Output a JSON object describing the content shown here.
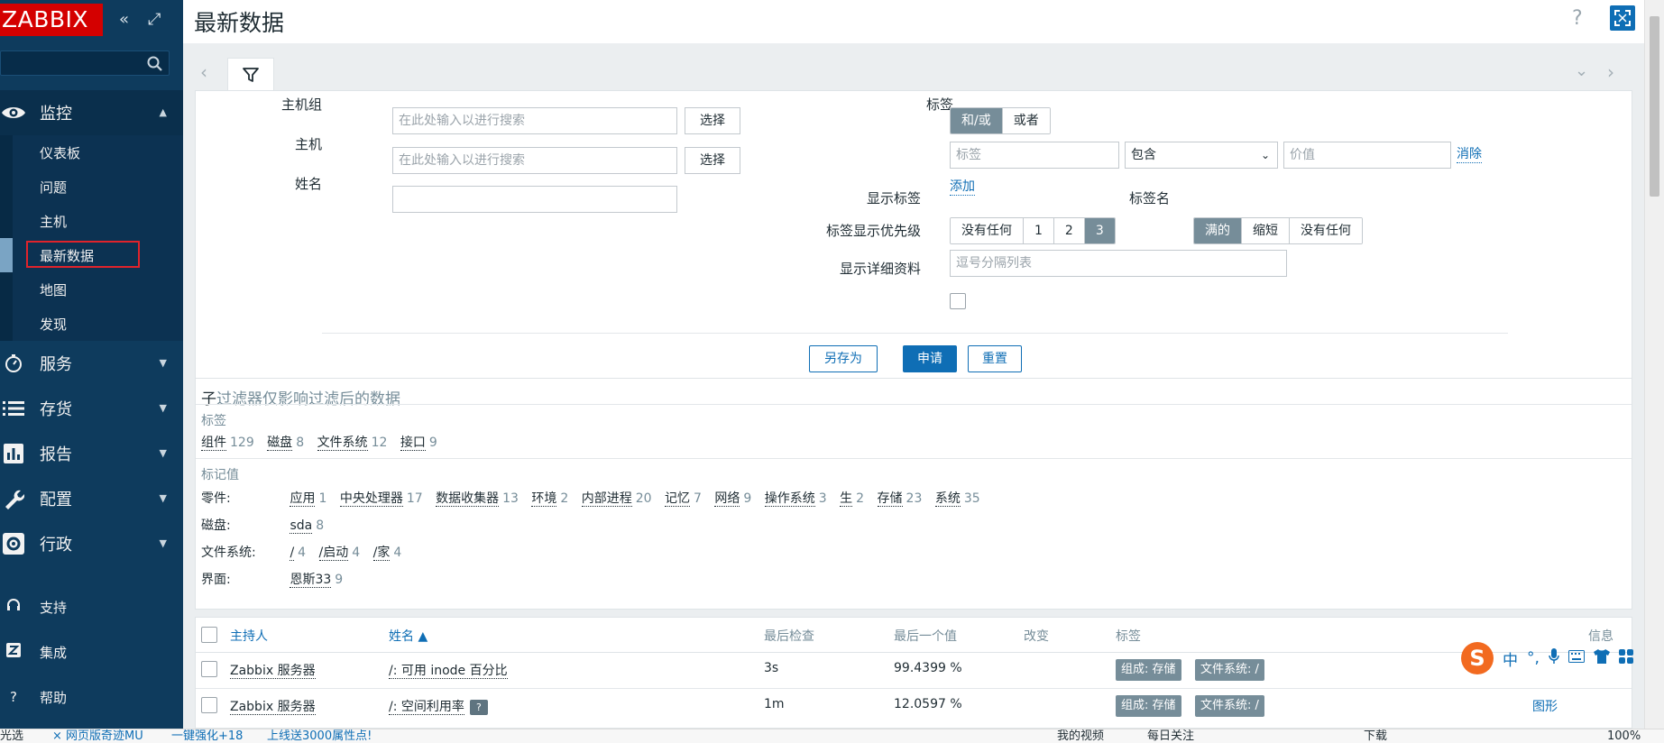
{
  "sidebar": {
    "logo": "ZABBIX",
    "collapse_icon": "«",
    "kiosk_icon": "⤢",
    "sections": [
      {
        "label": "监控",
        "icon": "eye-icon"
      },
      {
        "label": "服务",
        "icon": "stopwatch-icon"
      },
      {
        "label": "存货",
        "icon": "list-icon"
      },
      {
        "label": "报告",
        "icon": "chart-icon"
      },
      {
        "label": "配置",
        "icon": "wrench-icon"
      },
      {
        "label": "行政",
        "icon": "gear-icon"
      }
    ],
    "monitoring_items": [
      "仪表板",
      "问题",
      "主机",
      "最新数据",
      "地图",
      "发现"
    ],
    "bottom": [
      {
        "label": "支持",
        "icon": "headset-icon"
      },
      {
        "label": "集成",
        "icon": "z-icon"
      },
      {
        "label": "帮助",
        "icon": "question-icon"
      }
    ]
  },
  "header": {
    "title": "最新数据",
    "help": "?"
  },
  "filter": {
    "host_group_label": "主机组",
    "host_label": "主机",
    "name_label": "姓名",
    "search_placeholder": "在此处输入以进行搜索",
    "select_label": "选择",
    "tags_label": "标签",
    "tag_mode_and": "和/或",
    "tag_mode_or": "或者",
    "tag_placeholder": "标签",
    "operator_value": "包含",
    "value_placeholder": "价值",
    "remove_label": "消除",
    "add_label": "添加",
    "show_tags_label": "显示标签",
    "show_tags_options": [
      "没有任何",
      "1",
      "2",
      "3"
    ],
    "tag_name_label": "标签名",
    "tag_name_options": [
      "满的",
      "缩短",
      "没有任何"
    ],
    "tag_priority_label": "标签显示优先级",
    "tag_priority_placeholder": "逗号分隔列表",
    "show_details_label": "显示详细资料",
    "save_as": "另存为",
    "apply": "申请",
    "reset": "重置"
  },
  "subfilter": {
    "title_first": "子",
    "title_rest": "过滤器仅影响过滤后的数据",
    "tags_header": "标签",
    "tags": [
      {
        "name": "组件",
        "count": "129"
      },
      {
        "name": "磁盘",
        "count": "8"
      },
      {
        "name": "文件系统",
        "count": "12"
      },
      {
        "name": "接口",
        "count": "9"
      }
    ],
    "tag_values_header": "标记值",
    "rows": [
      {
        "name": "零件:",
        "items": [
          {
            "v": "应用",
            "c": "1"
          },
          {
            "v": "中央处理器",
            "c": "17"
          },
          {
            "v": "数据收集器",
            "c": "13"
          },
          {
            "v": "环境",
            "c": "2"
          },
          {
            "v": "内部进程",
            "c": "20"
          },
          {
            "v": "记忆",
            "c": "7"
          },
          {
            "v": "网络",
            "c": "9"
          },
          {
            "v": "操作系统",
            "c": "3"
          },
          {
            "v": "生",
            "c": "2"
          },
          {
            "v": "存储",
            "c": "23"
          },
          {
            "v": "系统",
            "c": "35"
          }
        ]
      },
      {
        "name": "磁盘:",
        "items": [
          {
            "v": "sda",
            "c": "8"
          }
        ]
      },
      {
        "name": "文件系统:",
        "items": [
          {
            "v": "/",
            "c": "4"
          },
          {
            "v": "/启动",
            "c": "4"
          },
          {
            "v": "/家",
            "c": "4"
          }
        ]
      },
      {
        "name": "界面:",
        "items": [
          {
            "v": "恩斯33",
            "c": "9"
          }
        ]
      }
    ]
  },
  "table": {
    "headers": [
      "主持人",
      "姓名 ▲",
      "最后检查",
      "最后一个值",
      "改变",
      "标签",
      "信息"
    ],
    "rows": [
      {
        "host": "Zabbix 服务器",
        "name": "/: 可用 inode 百分比",
        "last_check": "3s",
        "last_value": "99.4399 %",
        "tags": [
          "组成: 存储",
          "文件系统: /"
        ],
        "info": ""
      },
      {
        "host": "Zabbix 服务器",
        "name": "/: 空间利用率",
        "last_check": "1m",
        "last_value": "12.0597 %",
        "tags": [
          "组成: 存储",
          "文件系统: /"
        ],
        "info": "图形"
      }
    ]
  },
  "ime": {
    "lang": "中",
    "punct": "°,"
  },
  "statusbar": {
    "items": [
      "光选",
      "× 网页版奇迹MU",
      "一键强化+18",
      "上线送3000属性点!",
      "我的视频",
      "每日关注",
      "下载",
      "100%"
    ]
  }
}
